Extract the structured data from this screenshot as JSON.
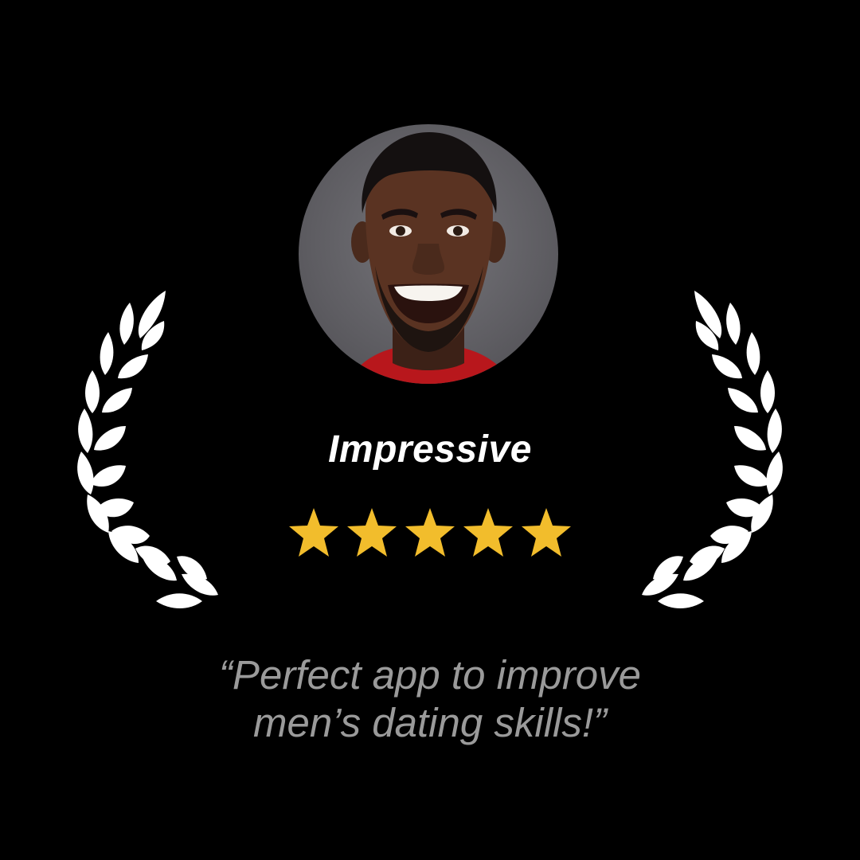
{
  "card": {
    "title": "Impressive",
    "rating": 5,
    "rating_max": 5,
    "quote_line1": "“Perfect app to improve",
    "quote_line2": "men’s dating skills!”"
  },
  "colors": {
    "background": "#000000",
    "title": "#ffffff",
    "star": "#f2bd2c",
    "quote": "#9a9a9a",
    "laurel": "#ffffff"
  },
  "icons": {
    "left_laurel": "laurel-branch-icon",
    "right_laurel": "laurel-branch-icon",
    "star": "star-icon"
  }
}
